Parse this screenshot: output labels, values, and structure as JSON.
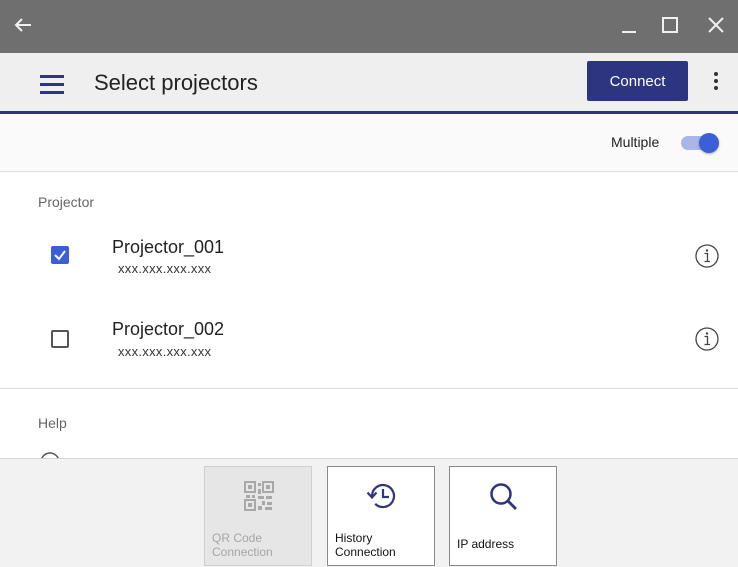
{
  "window": {
    "back_icon": "arrow-left-icon",
    "minimize_icon": "minimize-icon",
    "maximize_icon": "maximize-icon",
    "close_icon": "close-icon"
  },
  "appbar": {
    "title": "Select projectors",
    "connect_label": "Connect",
    "accent_color": "#2d3580"
  },
  "multiple": {
    "label": "Multiple",
    "enabled": true,
    "toggle_color": "#3a5fd9"
  },
  "projector_section": {
    "label": "Projector",
    "items": [
      {
        "name": "Projector_001",
        "ip": "xxx.xxx.xxx.xxx",
        "checked": true
      },
      {
        "name": "Projector_002",
        "ip": "xxx.xxx.xxx.xxx",
        "checked": false
      }
    ]
  },
  "help_section": {
    "label": "Help"
  },
  "bottom_actions": [
    {
      "label": "QR Code\nConnection",
      "icon": "qr-code-icon",
      "enabled": false
    },
    {
      "label": "History\nConnection",
      "icon": "history-icon",
      "enabled": true
    },
    {
      "label": "IP address",
      "icon": "search-icon",
      "enabled": true
    }
  ]
}
